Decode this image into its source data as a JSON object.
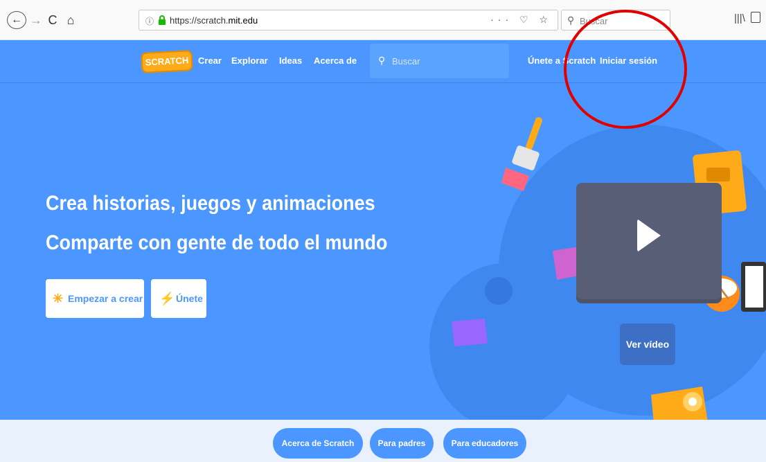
{
  "browser": {
    "back_glyph": "←",
    "forward_glyph": "→",
    "reload_glyph": "C",
    "home_glyph": "⌂",
    "info_glyph": "ⓘ",
    "url_prefix": "https://scratch.",
    "url_domain": "mit.edu",
    "tools_glyphs": "··· ♡ ☆",
    "search_glyph": "⚲",
    "search_placeholder": "Buscar",
    "library_glyph": "|||\\"
  },
  "nav": {
    "logo_text": "SCRATCH",
    "links": [
      "Crear",
      "Explorar",
      "Ideas",
      "Acerca de"
    ],
    "search_placeholder": "Buscar",
    "join_label": "Únete a Scratch",
    "signin_label": "Iniciar sesión"
  },
  "hero": {
    "title_line1": "Crea historias, juegos y animaciones",
    "title_line2": "Comparte con gente de todo el mundo",
    "start_label": "Empezar a crear",
    "start_icon": "✳",
    "join_label": "Únete",
    "join_icon": "⚡",
    "video_label": "Ver vídeo"
  },
  "lower": {
    "pills": [
      "Acerca de Scratch",
      "Para padres",
      "Para educadores"
    ]
  },
  "colors": {
    "brand_blue": "#4c97ff",
    "logo_orange": "#ffab19",
    "annotation_red": "#e00000"
  }
}
